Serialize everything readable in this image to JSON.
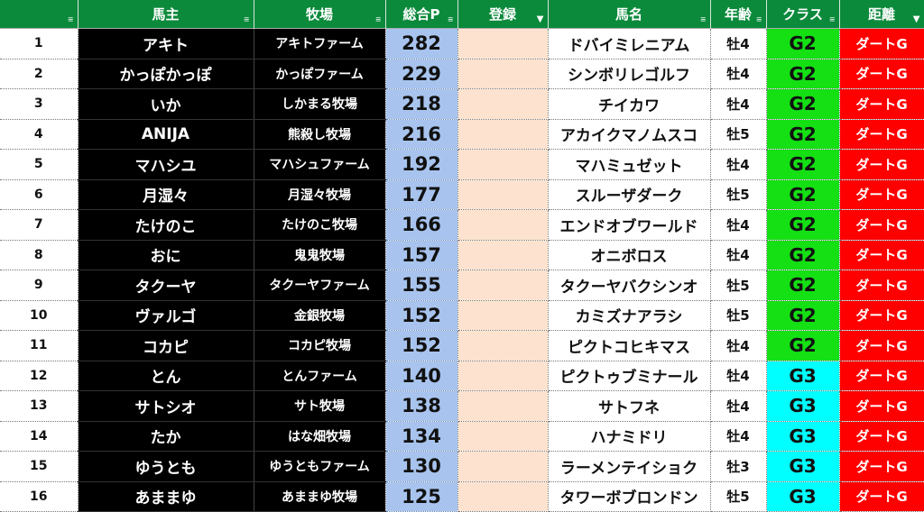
{
  "header": {
    "columns": [
      {
        "key": "no",
        "label": "",
        "filter": "sort"
      },
      {
        "key": "owner",
        "label": "馬主",
        "filter": "sort"
      },
      {
        "key": "farm",
        "label": "牧場",
        "filter": "sort"
      },
      {
        "key": "points",
        "label": "総合P",
        "filter": "sort"
      },
      {
        "key": "registered",
        "label": "登録",
        "filter": "filtered"
      },
      {
        "key": "horse",
        "label": "馬名",
        "filter": "sort"
      },
      {
        "key": "age",
        "label": "年齢",
        "filter": "sort"
      },
      {
        "key": "class",
        "label": "クラス",
        "filter": "sort"
      },
      {
        "key": "distance",
        "label": "距離",
        "filter": "filtered"
      }
    ]
  },
  "colors": {
    "G2": "#14e014",
    "G3": "#00ffff",
    "header": "#0b8a3c",
    "distance": "#ff0000",
    "points": "#a8c4ee",
    "registered": "#fde3cf"
  },
  "rows": [
    {
      "no": "1",
      "owner": "アキト",
      "farm": "アキトファーム",
      "points": "282",
      "registered": "",
      "horse": "ドバイミレニアム",
      "age": "牡4",
      "class": "G2",
      "distance": "ダートG"
    },
    {
      "no": "2",
      "owner": "かっぽかっぽ",
      "farm": "かっぽファーム",
      "points": "229",
      "registered": "",
      "horse": "シンボリレゴルフ",
      "age": "牡4",
      "class": "G2",
      "distance": "ダートG"
    },
    {
      "no": "3",
      "owner": "いか",
      "farm": "しかまる牧場",
      "points": "218",
      "registered": "",
      "horse": "チイカワ",
      "age": "牡4",
      "class": "G2",
      "distance": "ダートG"
    },
    {
      "no": "4",
      "owner": "ANIJA",
      "farm": "熊殺し牧場",
      "points": "216",
      "registered": "",
      "horse": "アカイクマノムスコ",
      "age": "牡5",
      "class": "G2",
      "distance": "ダートG"
    },
    {
      "no": "5",
      "owner": "マハシユ",
      "farm": "マハシュファーム",
      "points": "192",
      "registered": "",
      "horse": "マハミュゼット",
      "age": "牡4",
      "class": "G2",
      "distance": "ダートG"
    },
    {
      "no": "6",
      "owner": "月湿々",
      "farm": "月湿々牧場",
      "points": "177",
      "registered": "",
      "horse": "スルーザダーク",
      "age": "牡5",
      "class": "G2",
      "distance": "ダートG"
    },
    {
      "no": "7",
      "owner": "たけのこ",
      "farm": "たけのこ牧場",
      "points": "166",
      "registered": "",
      "horse": "エンドオブワールド",
      "age": "牡4",
      "class": "G2",
      "distance": "ダートG"
    },
    {
      "no": "8",
      "owner": "おに",
      "farm": "鬼鬼牧場",
      "points": "157",
      "registered": "",
      "horse": "オニボロス",
      "age": "牡4",
      "class": "G2",
      "distance": "ダートG"
    },
    {
      "no": "9",
      "owner": "タクーヤ",
      "farm": "タクーヤファーム",
      "points": "155",
      "registered": "",
      "horse": "タクーヤバクシンオ",
      "age": "牡5",
      "class": "G2",
      "distance": "ダートG"
    },
    {
      "no": "10",
      "owner": "ヴァルゴ",
      "farm": "金銀牧場",
      "points": "152",
      "registered": "",
      "horse": "カミズナアラシ",
      "age": "牡5",
      "class": "G2",
      "distance": "ダートG"
    },
    {
      "no": "11",
      "owner": "コカピ",
      "farm": "コカピ牧場",
      "points": "152",
      "registered": "",
      "horse": "ピクトコヒキマス",
      "age": "牡4",
      "class": "G2",
      "distance": "ダートG"
    },
    {
      "no": "12",
      "owner": "とん",
      "farm": "とんファーム",
      "points": "140",
      "registered": "",
      "horse": "ピクトゥブミナール",
      "age": "牡4",
      "class": "G3",
      "distance": "ダートG"
    },
    {
      "no": "13",
      "owner": "サトシオ",
      "farm": "サト牧場",
      "points": "138",
      "registered": "",
      "horse": "サトフネ",
      "age": "牡4",
      "class": "G3",
      "distance": "ダートG"
    },
    {
      "no": "14",
      "owner": "たか",
      "farm": "はな畑牧場",
      "points": "134",
      "registered": "",
      "horse": "ハナミドリ",
      "age": "牡4",
      "class": "G3",
      "distance": "ダートG"
    },
    {
      "no": "15",
      "owner": "ゆうとも",
      "farm": "ゆうともファーム",
      "points": "130",
      "registered": "",
      "horse": "ラーメンテイショク",
      "age": "牡3",
      "class": "G3",
      "distance": "ダートG"
    },
    {
      "no": "16",
      "owner": "あままゆ",
      "farm": "あままゆ牧場",
      "points": "125",
      "registered": "",
      "horse": "タワーボブロンドン",
      "age": "牡5",
      "class": "G3",
      "distance": "ダートG"
    }
  ]
}
